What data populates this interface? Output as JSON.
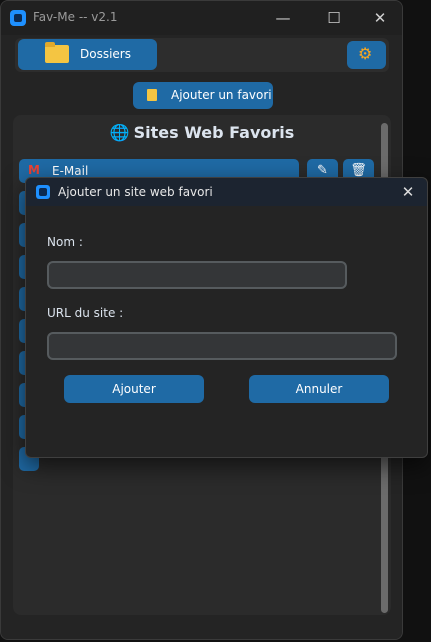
{
  "window": {
    "title": "Fav-Me -- v2.1",
    "controls": {
      "minimize": "—",
      "maximize": "☐",
      "close": "✕"
    }
  },
  "toolbar": {
    "folders_label": "Dossiers",
    "settings_icon": "gear-icon"
  },
  "add_favorite_label": "Ajouter un favori",
  "panel": {
    "title": "Sites Web Favoris",
    "items": [
      {
        "label": "E-Mail",
        "icon": "gmail-icon"
      }
    ],
    "edit_icon": "✎",
    "delete_icon": "🗑"
  },
  "dialog": {
    "title": "Ajouter un site web favori",
    "name_label": "Nom :",
    "name_value": "",
    "url_label": "URL du site :",
    "url_value": "",
    "ok_label": "Ajouter",
    "cancel_label": "Annuler",
    "close_glyph": "✕"
  },
  "colors": {
    "accent": "#1f6aa5",
    "background": "#242424",
    "panel": "#2b2b2b"
  }
}
